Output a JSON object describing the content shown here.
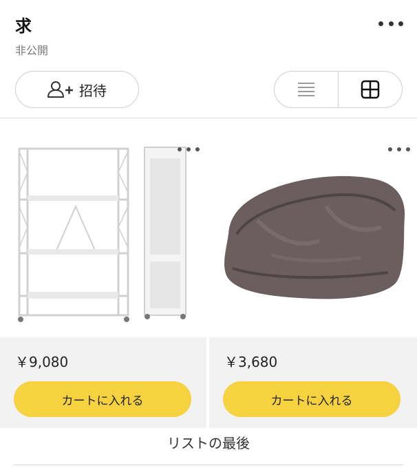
{
  "header": {
    "title": "求",
    "subtitle": "非公開",
    "more_icon": "more-horizontal-icon"
  },
  "toolbar": {
    "invite_label": "招待",
    "invite_icon": "add-person-icon",
    "list_view_icon": "list-icon",
    "grid_view_icon": "grid-icon",
    "active_view": "grid"
  },
  "items": [
    {
      "image": "white-folding-shelf-rack",
      "price": "￥9,080",
      "cart_label": "カートに入れる"
    },
    {
      "image": "gray-folded-blanket",
      "price": "￥3,680",
      "cart_label": "カートに入れる"
    }
  ],
  "footer": {
    "end_text": "リストの最後"
  },
  "colors": {
    "accent": "#f6d241",
    "muted": "#7a7a7a",
    "card_background": "#f2f2f2"
  }
}
